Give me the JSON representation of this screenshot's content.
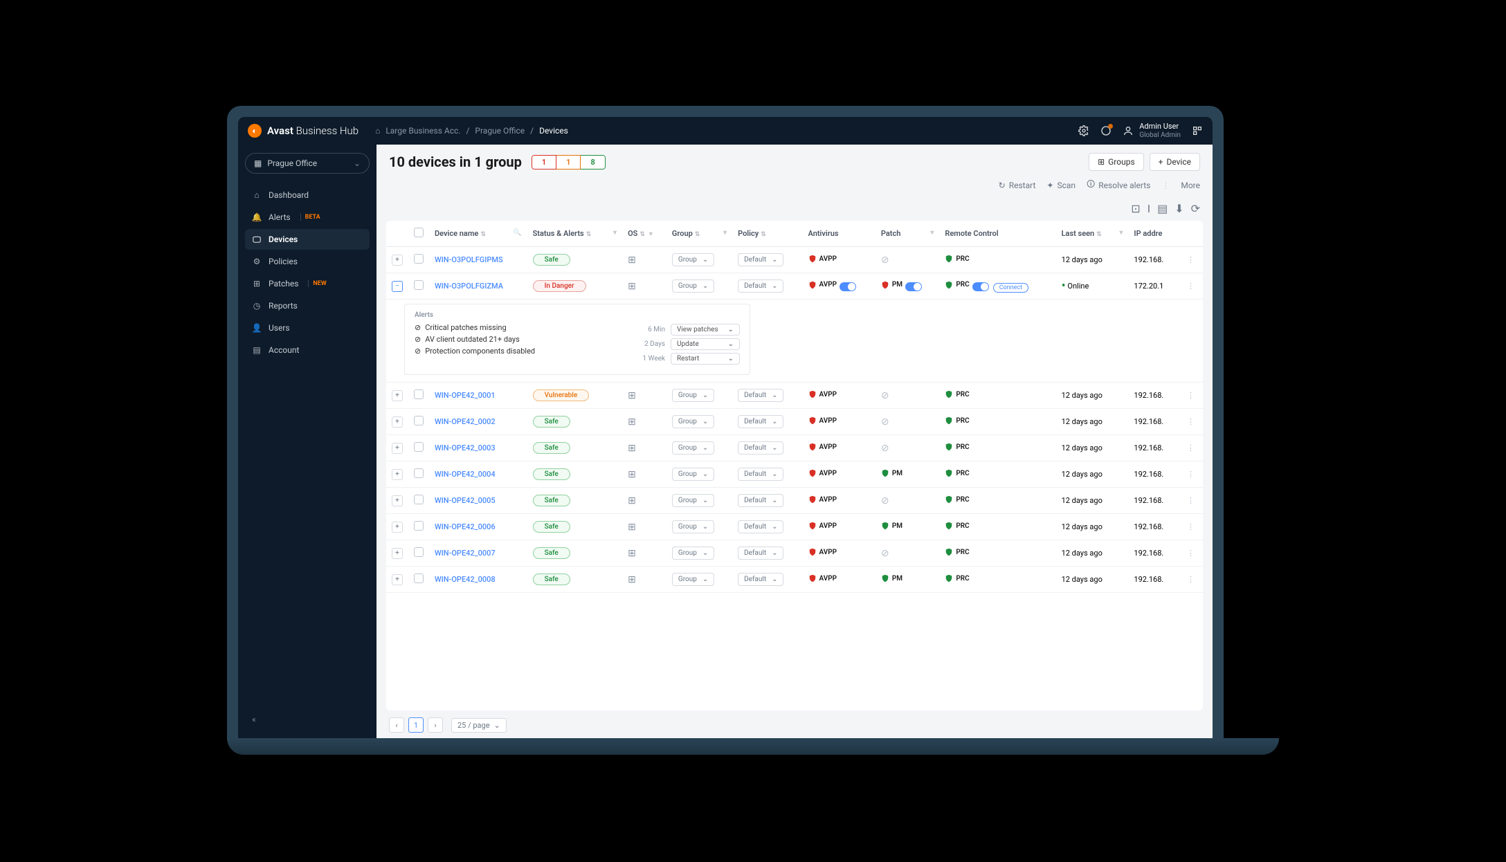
{
  "brand": {
    "name": "Avast",
    "suffix": "Business Hub"
  },
  "breadcrumbs": {
    "home": "Large Business Acc.",
    "office": "Prague Office",
    "page": "Devices"
  },
  "header_user": {
    "name": "Admin User",
    "role": "Global Admin"
  },
  "sidebar": {
    "office_selector": "Prague Office",
    "items": [
      {
        "label": "Dashboard",
        "icon": "home"
      },
      {
        "label": "Alerts",
        "icon": "bell",
        "badge": "BETA"
      },
      {
        "label": "Devices",
        "icon": "monitor",
        "active": true
      },
      {
        "label": "Policies",
        "icon": "sliders"
      },
      {
        "label": "Patches",
        "icon": "grid",
        "badge": "NEW"
      },
      {
        "label": "Reports",
        "icon": "clock"
      },
      {
        "label": "Users",
        "icon": "user"
      },
      {
        "label": "Account",
        "icon": "doc"
      }
    ]
  },
  "page": {
    "title": "10 devices in 1 group",
    "status_counts": {
      "red": "1",
      "orange": "1",
      "green": "8"
    },
    "buttons": {
      "groups": "Groups",
      "device": "Device"
    },
    "toolbar": {
      "restart": "Restart",
      "scan": "Scan",
      "resolve": "Resolve alerts",
      "more": "More"
    }
  },
  "columns": {
    "device": "Device name",
    "status": "Status & Alerts",
    "os": "OS",
    "group": "Group",
    "policy": "Policy",
    "antivirus": "Antivirus",
    "patch": "Patch",
    "remote": "Remote Control",
    "lastseen": "Last seen",
    "ip": "IP addre"
  },
  "group_default": "Group",
  "policy_default": "Default",
  "labels": {
    "avpp": "AVPP",
    "pm": "PM",
    "prc": "PRC",
    "connect": "Connect",
    "online": "Online"
  },
  "rows": [
    {
      "name": "WIN-O3POLFGIPMS",
      "status": "Safe",
      "status_class": "safe",
      "av_style": "red",
      "patch": "off",
      "prc_toggle": false,
      "lastseen": "12 days ago",
      "ip": "192.168.",
      "expanded": false
    },
    {
      "name": "WIN-O3POLFGIZMA",
      "status": "In Danger",
      "status_class": "danger",
      "av_style": "red_toggle",
      "patch": "pm_toggle",
      "prc_toggle": true,
      "connect": true,
      "lastseen": "Online",
      "online": true,
      "ip": "172.20.1",
      "expanded": true
    },
    {
      "name": "WIN-OPE42_0001",
      "status": "Vulnerable",
      "status_class": "vuln",
      "av_style": "red",
      "patch": "off",
      "prc_toggle": false,
      "lastseen": "12 days ago",
      "ip": "192.168."
    },
    {
      "name": "WIN-OPE42_0002",
      "status": "Safe",
      "status_class": "safe",
      "av_style": "red",
      "patch": "off",
      "prc_toggle": false,
      "lastseen": "12 days ago",
      "ip": "192.168."
    },
    {
      "name": "WIN-OPE42_0003",
      "status": "Safe",
      "status_class": "safe",
      "av_style": "red",
      "patch": "off",
      "prc_toggle": false,
      "lastseen": "12 days ago",
      "ip": "192.168."
    },
    {
      "name": "WIN-OPE42_0004",
      "status": "Safe",
      "status_class": "safe",
      "av_style": "red",
      "patch": "pm",
      "prc_toggle": false,
      "lastseen": "12 days ago",
      "ip": "192.168."
    },
    {
      "name": "WIN-OPE42_0005",
      "status": "Safe",
      "status_class": "safe",
      "av_style": "red",
      "patch": "off",
      "prc_toggle": false,
      "lastseen": "12 days ago",
      "ip": "192.168."
    },
    {
      "name": "WIN-OPE42_0006",
      "status": "Safe",
      "status_class": "safe",
      "av_style": "red",
      "patch": "pm",
      "prc_toggle": false,
      "lastseen": "12 days ago",
      "ip": "192.168."
    },
    {
      "name": "WIN-OPE42_0007",
      "status": "Safe",
      "status_class": "safe",
      "av_style": "red",
      "patch": "off",
      "prc_toggle": false,
      "lastseen": "12 days ago",
      "ip": "192.168."
    },
    {
      "name": "WIN-OPE42_0008",
      "status": "Safe",
      "status_class": "safe",
      "av_style": "red",
      "patch": "pm",
      "prc_toggle": false,
      "lastseen": "12 days ago",
      "ip": "192.168."
    }
  ],
  "alerts_panel": {
    "title": "Alerts",
    "lines": [
      {
        "text": "Critical patches missing",
        "time": "6 Min",
        "action": "View patches"
      },
      {
        "text": "AV client outdated 21+ days",
        "time": "2 Days",
        "action": "Update"
      },
      {
        "text": "Protection components disabled",
        "time": "1 Week",
        "action": "Restart"
      }
    ]
  },
  "pagination": {
    "page": "1",
    "size": "25 / page"
  }
}
